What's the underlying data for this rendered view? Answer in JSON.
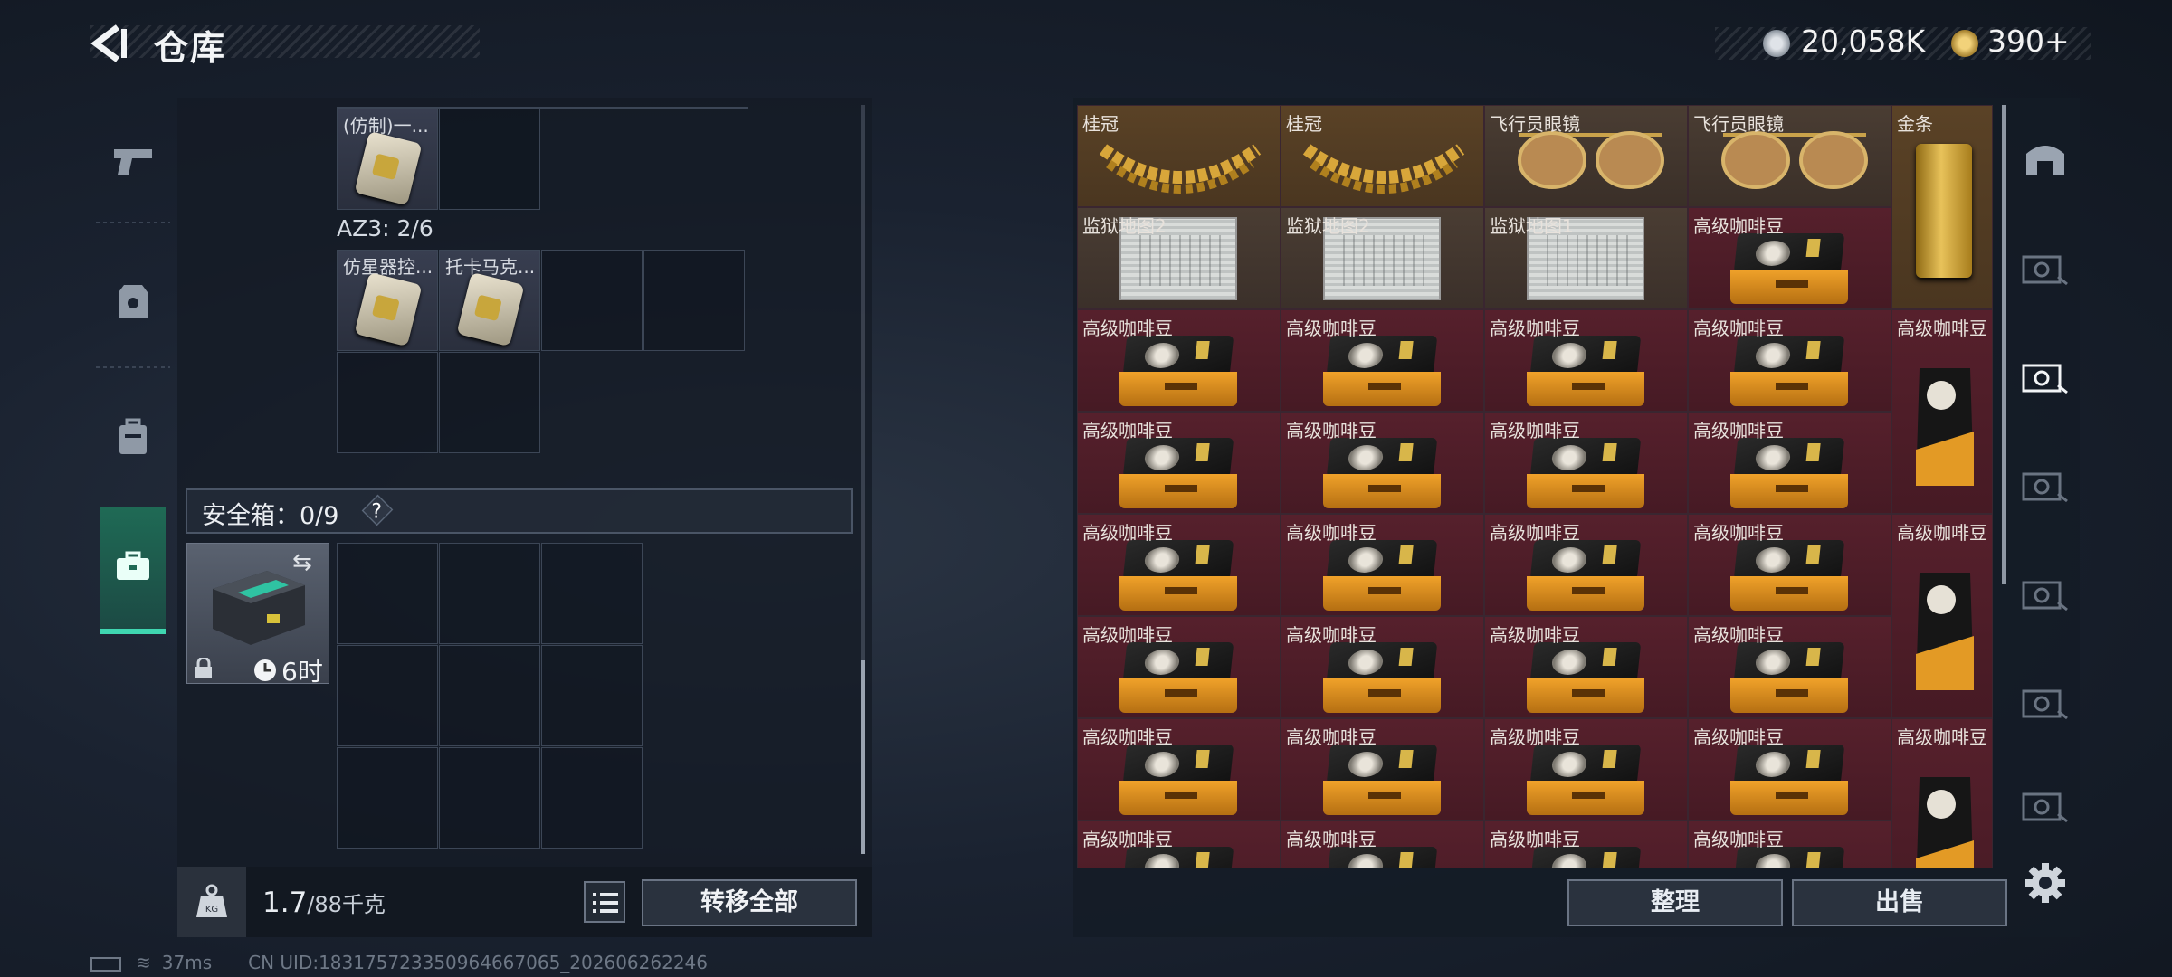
{
  "header": {
    "title": "仓库"
  },
  "currency": {
    "primary": "20,058K",
    "secondary": "390+"
  },
  "left": {
    "grid_items": [
      {
        "label": "(仿制)一..."
      },
      {
        "label": "仿星器控..."
      },
      {
        "label": "托卡马克..."
      }
    ],
    "az3_label": "AZ3: 2/6",
    "safe_title": "安全箱：0/9",
    "help": "?",
    "safebox_timer": "6时",
    "weight_value": "1.7",
    "weight_max": "/88千克",
    "transfer_label": "转移全部"
  },
  "right": {
    "row1": [
      "桂冠",
      "桂冠",
      "飞行员眼镜",
      "飞行员眼镜"
    ],
    "gold_label": "金条",
    "row2": [
      "监狱地图2",
      "监狱地图2",
      "监狱地图1",
      "高级咖啡豆"
    ],
    "coffee_label": "高级咖啡豆",
    "tall_label": "高级咖啡豆",
    "sort_label": "整理",
    "sell_label": "出售"
  },
  "status": {
    "ping": "37ms",
    "uid": "CN UID:18317572335096466706​5_202606262246"
  },
  "colors": {
    "accent": "#3fd6b0",
    "item_red": "#56202c",
    "item_brown": "#4a3d33"
  }
}
